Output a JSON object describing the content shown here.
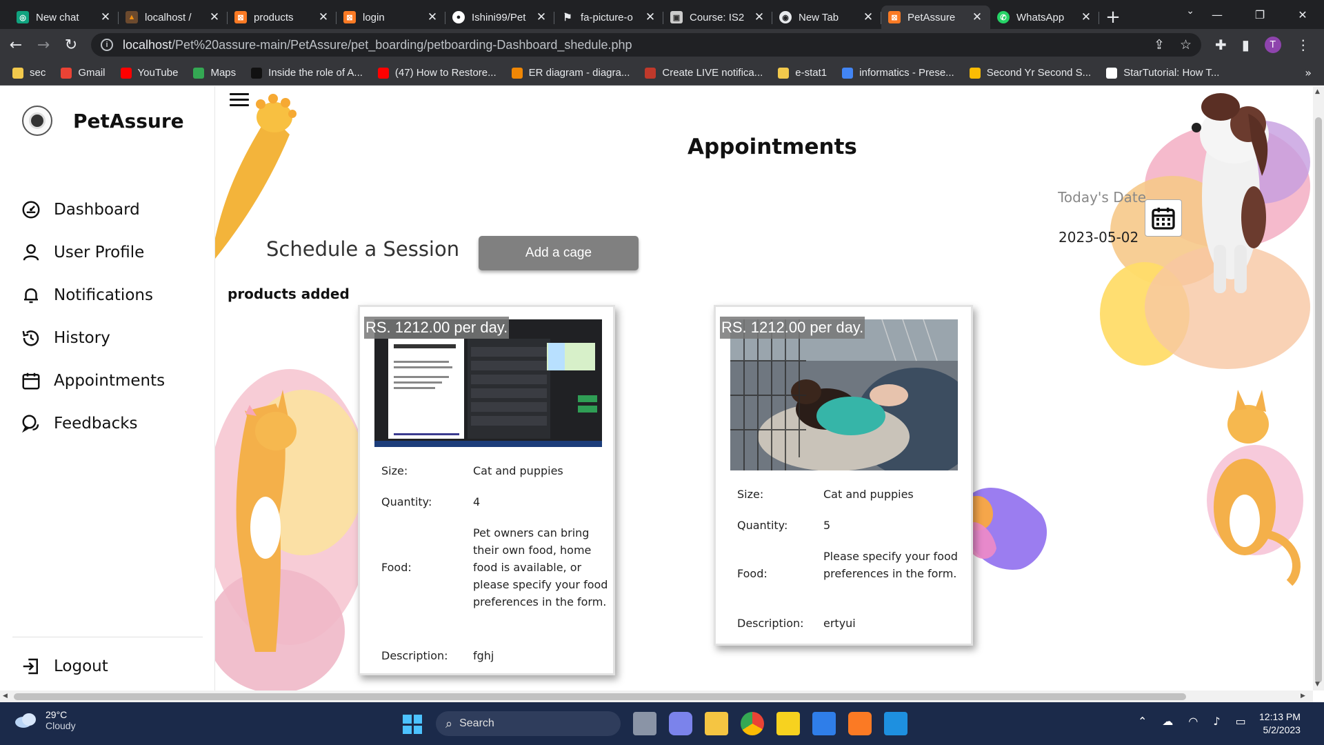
{
  "browser": {
    "tabs": [
      {
        "title": "New chat",
        "fav_color": "#10a37f",
        "fav_glyph": "◎"
      },
      {
        "title": "localhost /",
        "fav_color": "#6c4a2e",
        "fav_glyph": "▲"
      },
      {
        "title": "products",
        "fav_color": "#fb7a24",
        "fav_glyph": "⊠"
      },
      {
        "title": "login",
        "fav_color": "#fb7a24",
        "fav_glyph": "⊠"
      },
      {
        "title": "Ishini99/Pet",
        "fav_color": "#ffffff",
        "fav_glyph": "●"
      },
      {
        "title": "fa-picture-o",
        "fav_color": "#202124",
        "fav_glyph": "⚑"
      },
      {
        "title": "Course: IS2",
        "fav_color": "#cccccc",
        "fav_glyph": "▣"
      },
      {
        "title": "New Tab",
        "fav_color": "#e8eaed",
        "fav_glyph": "◉"
      },
      {
        "title": "PetAssure",
        "fav_color": "#fb7a24",
        "fav_glyph": "⊠",
        "active": true
      },
      {
        "title": "WhatsApp",
        "fav_color": "#25d366",
        "fav_glyph": "✆"
      }
    ],
    "url_host": "localhost",
    "url_path": "/Pet%20assure-main/PetAssure/pet_boarding/petboarding-Dashboard_shedule.php",
    "profile_initial": "T",
    "bookmarks": [
      {
        "label": "sec",
        "color": "#f2c94c"
      },
      {
        "label": "Gmail",
        "color": "#ea4335"
      },
      {
        "label": "YouTube",
        "color": "#ff0000"
      },
      {
        "label": "Maps",
        "color": "#34a853"
      },
      {
        "label": "Inside the role of A...",
        "color": "#111111"
      },
      {
        "label": "(47) How to Restore...",
        "color": "#ff0000"
      },
      {
        "label": "ER diagram - diagra...",
        "color": "#f08705"
      },
      {
        "label": "Create LIVE notifica...",
        "color": "#c0392b"
      },
      {
        "label": "e-stat1",
        "color": "#f2c94c"
      },
      {
        "label": "informatics - Prese...",
        "color": "#4285f4"
      },
      {
        "label": "Second Yr Second S...",
        "color": "#fbbc04"
      },
      {
        "label": "StarTutorial: How T...",
        "color": "#ffffff"
      }
    ]
  },
  "sidebar": {
    "brand": "PetAssure",
    "items": [
      {
        "label": "Dashboard",
        "icon": "dashboard-icon"
      },
      {
        "label": "User Profile",
        "icon": "user-icon"
      },
      {
        "label": "Notifications",
        "icon": "bell-icon"
      },
      {
        "label": "History",
        "icon": "history-icon"
      },
      {
        "label": "Appointments",
        "icon": "calendar-icon"
      },
      {
        "label": "Feedbacks",
        "icon": "feedback-icon"
      }
    ],
    "logout": "Logout"
  },
  "main": {
    "title": "Appointments",
    "schedule_heading": "Schedule a Session",
    "add_cage_label": "Add a cage",
    "products_added": "products added",
    "today_label": "Today's Date",
    "today_date": "2023-05-02"
  },
  "labels": {
    "size": "Size:",
    "quantity": "Quantity:",
    "food": "Food:",
    "description": "Description:"
  },
  "cards": [
    {
      "price": "RS. 1212.00 per day.",
      "size": "Cat and puppies",
      "quantity": "4",
      "food": "Pet owners can bring their own food, home food is available, or please specify your food preferences in the form.",
      "description": "fghj"
    },
    {
      "price": "RS. 1212.00 per day.",
      "size": "Cat and puppies",
      "quantity": "5",
      "food": "Please specify your food preferences in the form.",
      "description": "ertyui"
    }
  ],
  "taskbar": {
    "temp": "29°C",
    "weather": "Cloudy",
    "search": "Search",
    "time": "12:13 PM",
    "date": "5/2/2023"
  }
}
